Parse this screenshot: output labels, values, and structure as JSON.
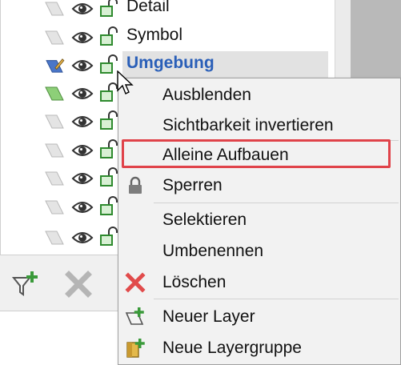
{
  "layers": [
    {
      "name": "Detail",
      "swatch": "#dcdcdc",
      "selected": false
    },
    {
      "name": "Symbol",
      "swatch": "#dcdcdc",
      "selected": false
    },
    {
      "name": "Umgebung",
      "swatch": "#4a76c8",
      "selected": true
    },
    {
      "name": "",
      "swatch": "#8dcf78",
      "selected": false
    },
    {
      "name": "",
      "swatch": "#dcdcdc",
      "selected": false
    },
    {
      "name": "",
      "swatch": "#dcdcdc",
      "selected": false
    },
    {
      "name": "",
      "swatch": "#dcdcdc",
      "selected": false
    },
    {
      "name": "",
      "swatch": "#dcdcdc",
      "selected": false
    },
    {
      "name": "",
      "swatch": "#dcdcdc",
      "selected": false
    }
  ],
  "toolbar": {
    "buttons": [
      {
        "icon": "filter-add-icon",
        "enabled": true
      },
      {
        "icon": "delete-icon",
        "enabled": false
      }
    ]
  },
  "context_menu": {
    "items": [
      {
        "label": "Ausblenden",
        "icon": "",
        "highlighted": false
      },
      {
        "label": "Sichtbarkeit invertieren",
        "icon": "",
        "highlighted": false
      },
      {
        "label": "Alleine Aufbauen",
        "icon": "",
        "highlighted": true
      },
      {
        "label": "Sperren",
        "icon": "lock-icon",
        "highlighted": false
      },
      {
        "label": "Selektieren",
        "icon": "",
        "highlighted": false
      },
      {
        "label": "Umbenennen",
        "icon": "",
        "highlighted": false
      },
      {
        "label": "Löschen",
        "icon": "delete-icon",
        "highlighted": false
      },
      {
        "label": "Neuer Layer",
        "icon": "new-layer-icon",
        "highlighted": false
      },
      {
        "label": "Neue Layergruppe",
        "icon": "new-layer-group-icon",
        "highlighted": false
      }
    ]
  },
  "colors": {
    "selected_text": "#2a5fb8",
    "highlight_border": "#e0434a",
    "menu_bg": "#f2f2f2",
    "lock_green": "#3a9a3a",
    "delete_red": "#e14b4b"
  }
}
